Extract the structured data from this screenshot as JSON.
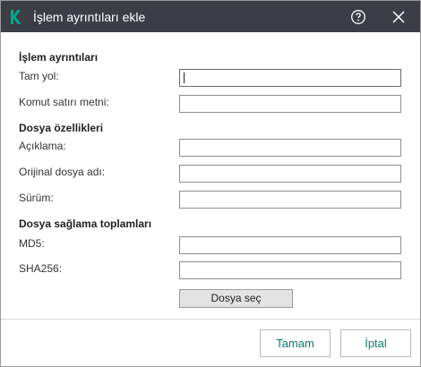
{
  "window": {
    "title": "İşlem ayrıntıları ekle",
    "icons": {
      "logo": "kaspersky-k-logo",
      "help": "help-circle-icon",
      "close": "close-icon"
    }
  },
  "sections": {
    "process_details": "İşlem ayrıntıları",
    "file_properties": "Dosya özellikleri",
    "checksums": "Dosya sağlama toplamları"
  },
  "fields": {
    "full_path": {
      "label": "Tam yol:",
      "value": ""
    },
    "command_line": {
      "label": "Komut satırı metni:",
      "value": ""
    },
    "description": {
      "label": "Açıklama:",
      "value": ""
    },
    "original_filename": {
      "label": "Orijinal dosya adı:",
      "value": ""
    },
    "version": {
      "label": "Sürüm:",
      "value": ""
    },
    "md5": {
      "label": "MD5:",
      "value": ""
    },
    "sha256": {
      "label": "SHA256:",
      "value": ""
    }
  },
  "buttons": {
    "choose_file": "Dosya seç",
    "ok": "Tamam",
    "cancel": "İptal"
  },
  "colors": {
    "titlebar": "#3b3f45",
    "accent": "#0a7d69",
    "logo": "#00a88e"
  }
}
